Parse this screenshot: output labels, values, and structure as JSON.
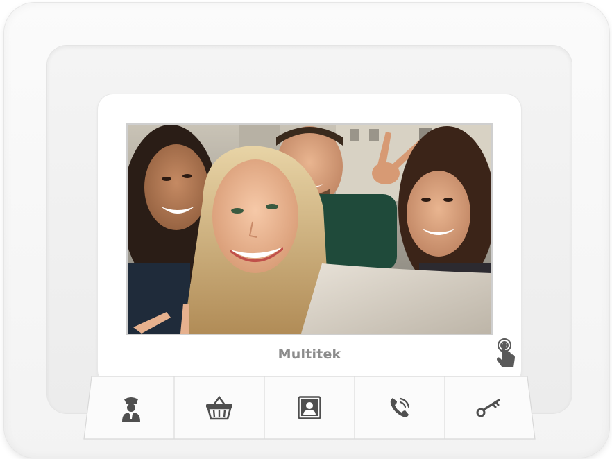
{
  "device": {
    "brand": "Multitek"
  },
  "screen": {
    "content": "live-video-feed"
  },
  "buttons": [
    {
      "id": "security",
      "icon": "security-guard-icon"
    },
    {
      "id": "shopping",
      "icon": "shopping-basket-icon"
    },
    {
      "id": "contacts",
      "icon": "contact-portrait-icon"
    },
    {
      "id": "call",
      "icon": "phone-call-icon"
    },
    {
      "id": "door",
      "icon": "key-icon"
    }
  ],
  "colors": {
    "shell": "#f6f6f6",
    "bezel": "#ffffff",
    "icon": "#5a5a5a",
    "logo": "#8c8c8c"
  }
}
